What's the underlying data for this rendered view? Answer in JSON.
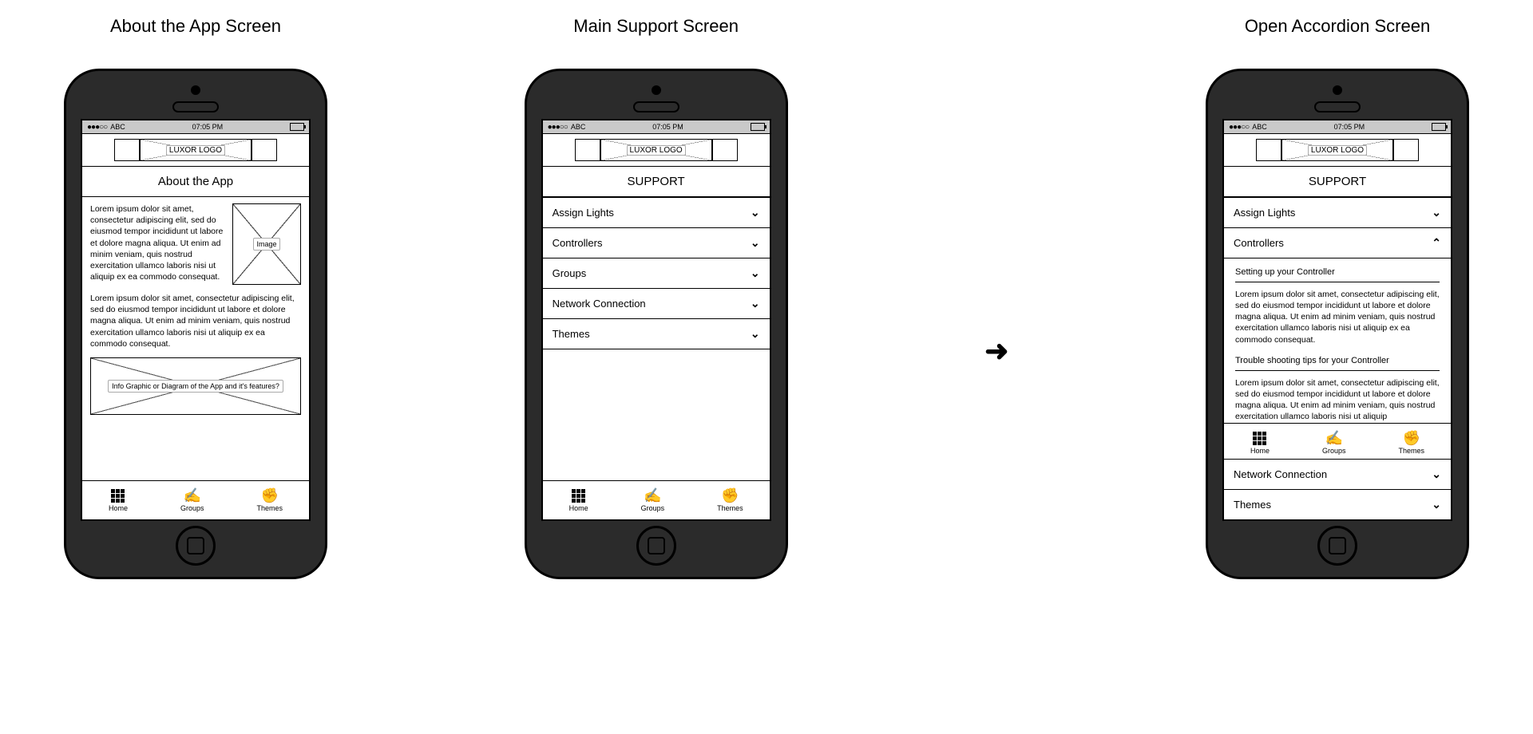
{
  "screens": {
    "about": {
      "title_label": "About the App Screen"
    },
    "support": {
      "title_label": "Main Support Screen"
    },
    "accordion": {
      "title_label": "Open Accordion Screen"
    }
  },
  "statusbar": {
    "carrier": "ABC",
    "time": "07:05 PM"
  },
  "logo_text": "LUXOR LOGO",
  "about_page": {
    "heading": "About the App",
    "para1": "Lorem ipsum dolor sit amet, consectetur adipiscing elit, sed do eiusmod tempor incididunt ut labore et dolore magna aliqua. Ut enim ad minim veniam, quis nostrud exercitation ullamco laboris nisi ut aliquip ex ea commodo consequat.",
    "image_label": "Image",
    "para2": "Lorem ipsum dolor sit amet, consectetur adipiscing elit, sed do eiusmod tempor incididunt ut labore et dolore magna aliqua. Ut enim ad minim veniam, quis nostrud exercitation ullamco laboris nisi ut aliquip ex ea commodo consequat.",
    "diagram_label": "Info Graphic or Diagram of the App and it's features?"
  },
  "support_page": {
    "heading": "SUPPORT",
    "items": [
      {
        "label": "Assign Lights"
      },
      {
        "label": "Controllers"
      },
      {
        "label": "Groups"
      },
      {
        "label": "Network Connection"
      },
      {
        "label": "Themes"
      }
    ]
  },
  "accordion_page": {
    "heading": "SUPPORT",
    "row_assign": "Assign Lights",
    "row_controllers": "Controllers",
    "sub1_title": "Setting up your Controller",
    "sub1_body": "Lorem ipsum dolor sit amet, consectetur adipiscing elit, sed do eiusmod tempor incididunt ut labore et dolore magna aliqua. Ut enim ad minim veniam, quis nostrud exercitation ullamco laboris nisi ut aliquip ex ea commodo consequat.",
    "sub2_title": "Trouble shooting tips for your Controller",
    "sub2_body": "Lorem ipsum dolor sit amet, consectetur adipiscing elit, sed do eiusmod tempor incididunt ut labore et dolore magna aliqua. Ut enim ad minim veniam, quis nostrud exercitation ullamco laboris nisi ut aliquip",
    "row_network": "Network Connection",
    "row_themes": "Themes"
  },
  "tabs": {
    "home": "Home",
    "groups": "Groups",
    "themes": "Themes"
  }
}
